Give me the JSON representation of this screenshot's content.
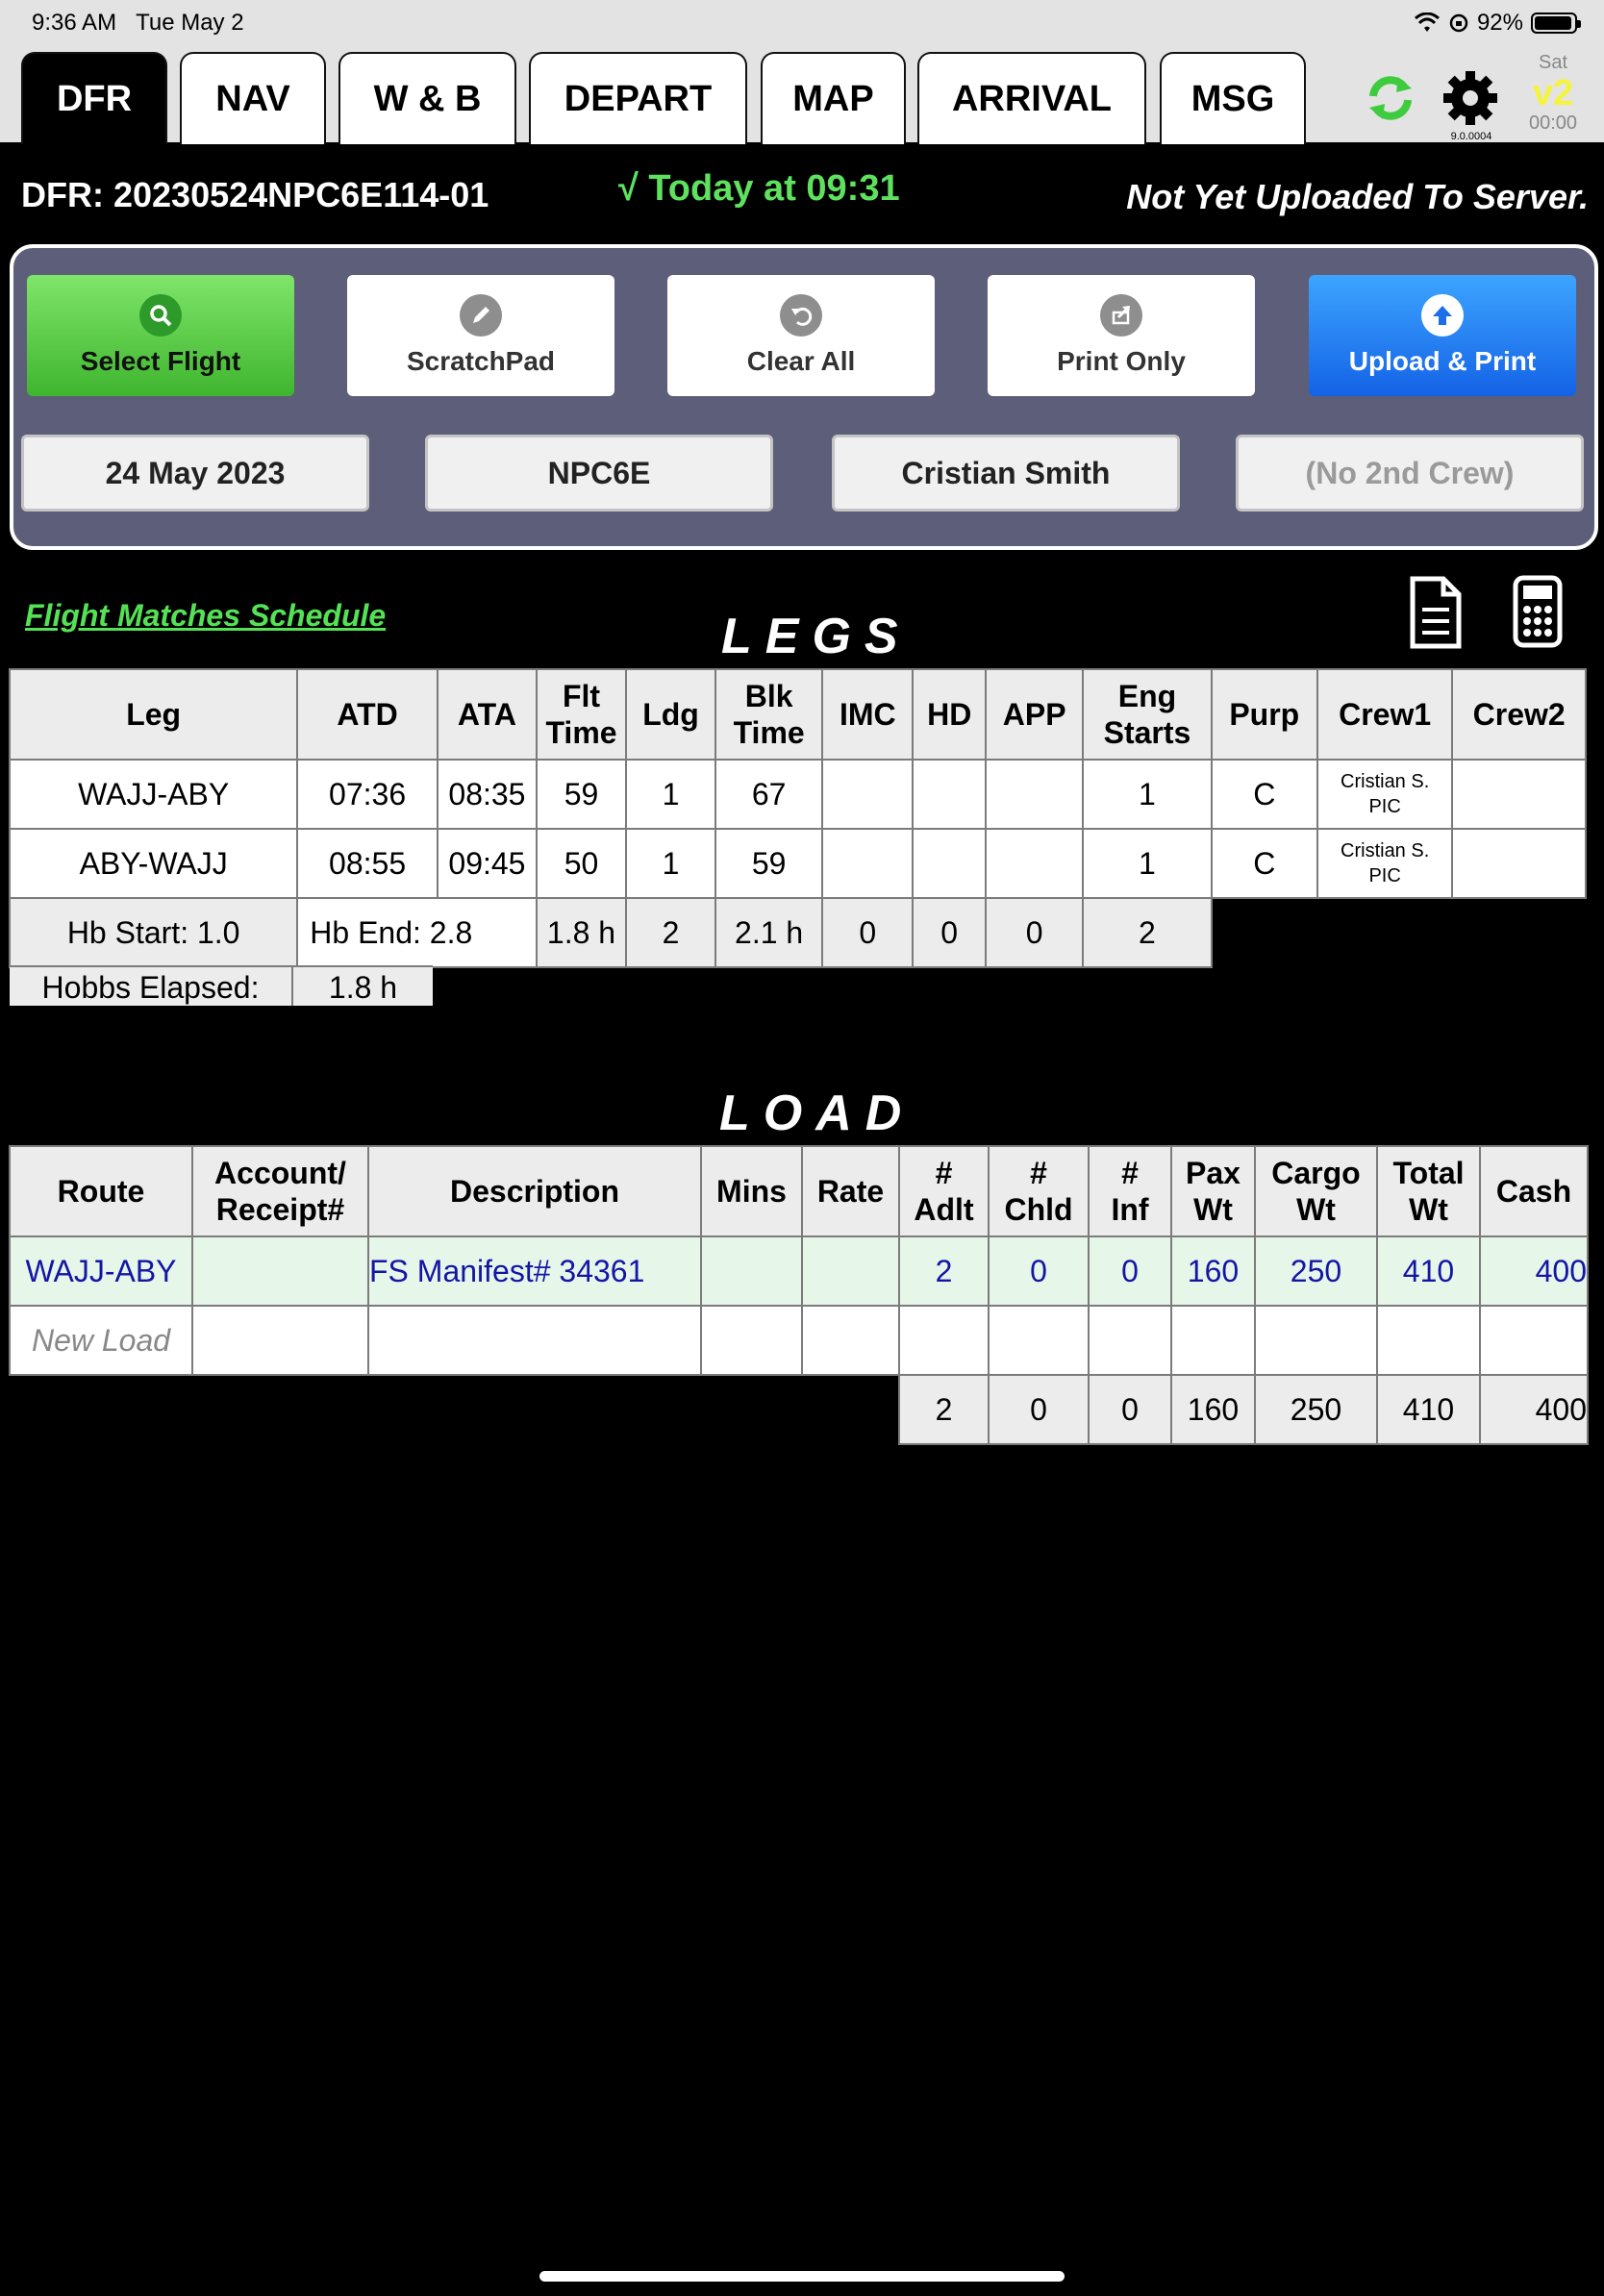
{
  "status_bar": {
    "time": "9:36 AM",
    "date": "Tue May 2",
    "battery": "92%"
  },
  "tabs": [
    {
      "label": "DFR",
      "active": true
    },
    {
      "label": "NAV"
    },
    {
      "label": "W & B"
    },
    {
      "label": "DEPART"
    },
    {
      "label": "MAP"
    },
    {
      "label": "ARRIVAL"
    },
    {
      "label": "MSG"
    }
  ],
  "tools": {
    "sync_icon": "sync-icon",
    "settings_icon": "gear-icon",
    "version": "9.0.0004",
    "sat_day": "Sat",
    "sat_label": "v2",
    "sat_time": "00:00"
  },
  "header": {
    "dfr_id": "DFR: 20230524NPC6E114-01",
    "today": "√ Today at 09:31",
    "upload_status": "Not Yet Uploaded To Server."
  },
  "actions": {
    "select_flight": "Select Flight",
    "scratchpad": "ScratchPad",
    "clear_all": "Clear All",
    "print_only": "Print Only",
    "upload_print": "Upload & Print"
  },
  "fields": {
    "date": "24 May 2023",
    "aircraft": "NPC6E",
    "crew1": "Cristian Smith",
    "crew2": "(No 2nd Crew)"
  },
  "flight_matches": "Flight Matches Schedule",
  "legs": {
    "title": "LEGS",
    "headers": [
      "Leg",
      "ATD",
      "ATA",
      "Flt\nTime",
      "Ldg",
      "Blk\nTime",
      "IMC",
      "HD",
      "APP",
      "Eng\nStarts",
      "Purp",
      "Crew1",
      "Crew2"
    ],
    "rows": [
      {
        "leg": "WAJJ-ABY",
        "atd": "07:36",
        "ata": "08:35",
        "flt": "59",
        "ldg": "1",
        "blk": "67",
        "imc": "",
        "hd": "",
        "app": "",
        "eng": "1",
        "purp": "C",
        "crew1_name": "Cristian S.",
        "crew1_role": "PIC",
        "crew2": ""
      },
      {
        "leg": "ABY-WAJJ",
        "atd": "08:55",
        "ata": "09:45",
        "flt": "50",
        "ldg": "1",
        "blk": "59",
        "imc": "",
        "hd": "",
        "app": "",
        "eng": "1",
        "purp": "C",
        "crew1_name": "Cristian S.",
        "crew1_role": "PIC",
        "crew2": ""
      }
    ],
    "totals": {
      "hb_start": "Hb Start: 1.0",
      "hb_end": "Hb End:  2.8",
      "flt": "1.8 h",
      "ldg": "2",
      "blk": "2.1 h",
      "imc": "0",
      "hd": "0",
      "app": "0",
      "eng": "2"
    },
    "hobbs_label": "Hobbs Elapsed:",
    "hobbs_value": "1.8 h"
  },
  "load": {
    "title": "LOAD",
    "headers": [
      "Route",
      "Account/\nReceipt#",
      "Description",
      "Mins",
      "Rate",
      "#\nAdlt",
      "#\nChld",
      "#\nInf",
      "Pax\nWt",
      "Cargo\nWt",
      "Total\nWt",
      "Cash"
    ],
    "rows": [
      {
        "route": "WAJJ-ABY",
        "account": "",
        "description": "FS Manifest# 34361",
        "mins": "",
        "rate": "",
        "adlt": "2",
        "chld": "0",
        "inf": "0",
        "pax": "160",
        "cargo": "250",
        "total": "410",
        "cash": "400"
      }
    ],
    "new_load": "New Load",
    "totals": {
      "adlt": "2",
      "chld": "0",
      "inf": "0",
      "pax": "160",
      "cargo": "250",
      "total": "410",
      "cash": "400"
    }
  }
}
